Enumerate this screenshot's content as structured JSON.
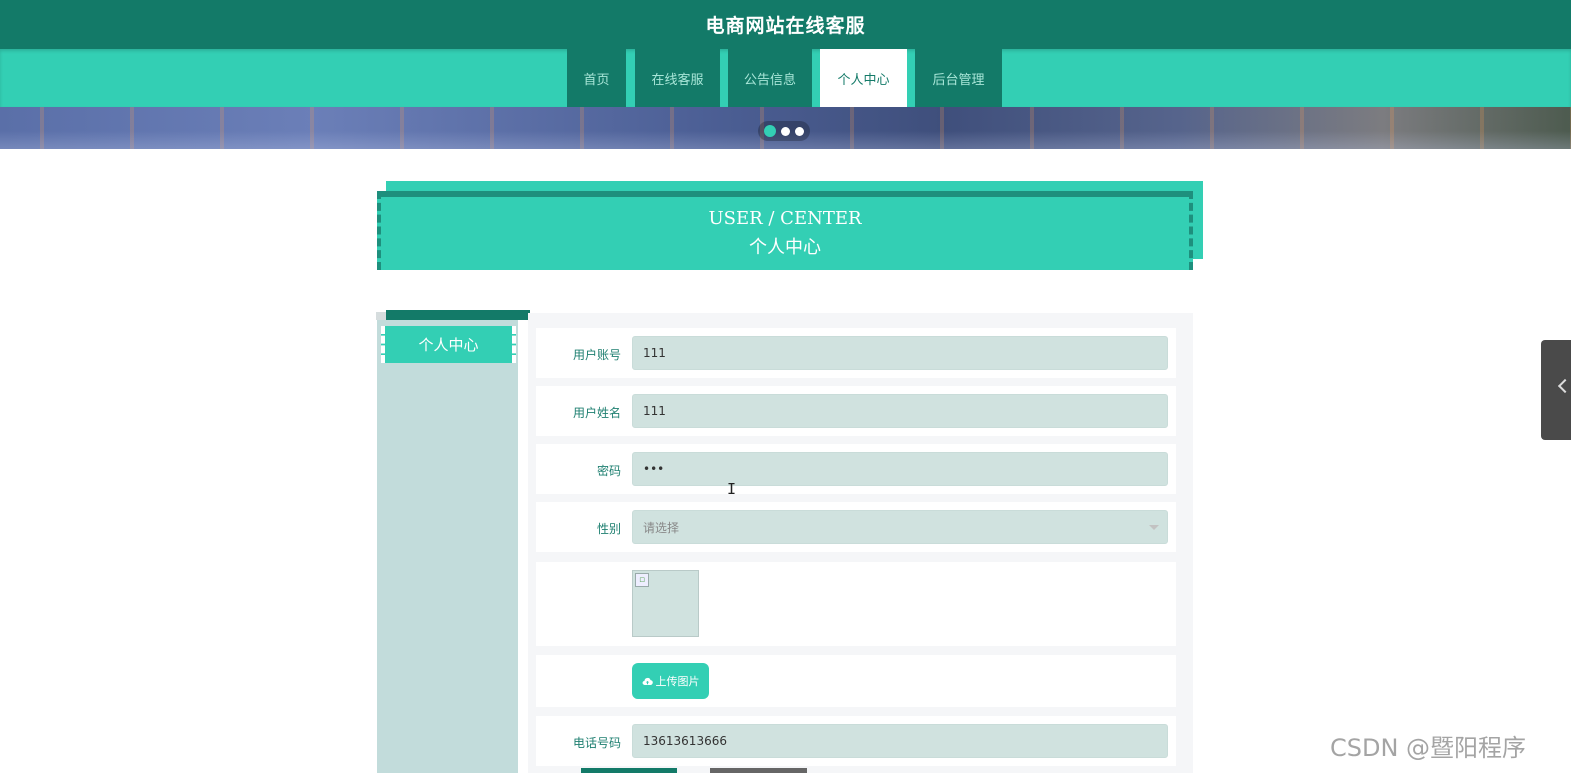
{
  "header": {
    "site_title": "电商网站在线客服"
  },
  "nav": {
    "items": [
      {
        "label": "首页"
      },
      {
        "label": "在线客服"
      },
      {
        "label": "公告信息"
      },
      {
        "label": "个人中心",
        "active": true
      },
      {
        "label": "后台管理"
      }
    ]
  },
  "banner": {
    "slide_count": 3,
    "active_slide": 1
  },
  "section": {
    "title_en": "USER / CENTER",
    "title_cn": "个人中心"
  },
  "sidebar": {
    "items": [
      {
        "label": "个人中心"
      }
    ]
  },
  "form": {
    "account": {
      "label": "用户账号",
      "value": "111"
    },
    "name": {
      "label": "用户姓名",
      "value": "111"
    },
    "password": {
      "label": "密码",
      "value": "•••"
    },
    "gender": {
      "label": "性别",
      "placeholder": "请选择"
    },
    "upload": {
      "label": "上传图片",
      "icon": "cloud-upload-icon"
    },
    "phone": {
      "label": "电话号码",
      "value": "13613613666"
    }
  },
  "watermark": "CSDN @暨阳程序",
  "colors": {
    "primary": "#33cfb4",
    "dark": "#137a68",
    "input_bg": "#d0e2df",
    "sidebar_bg": "#c2dcdb"
  }
}
